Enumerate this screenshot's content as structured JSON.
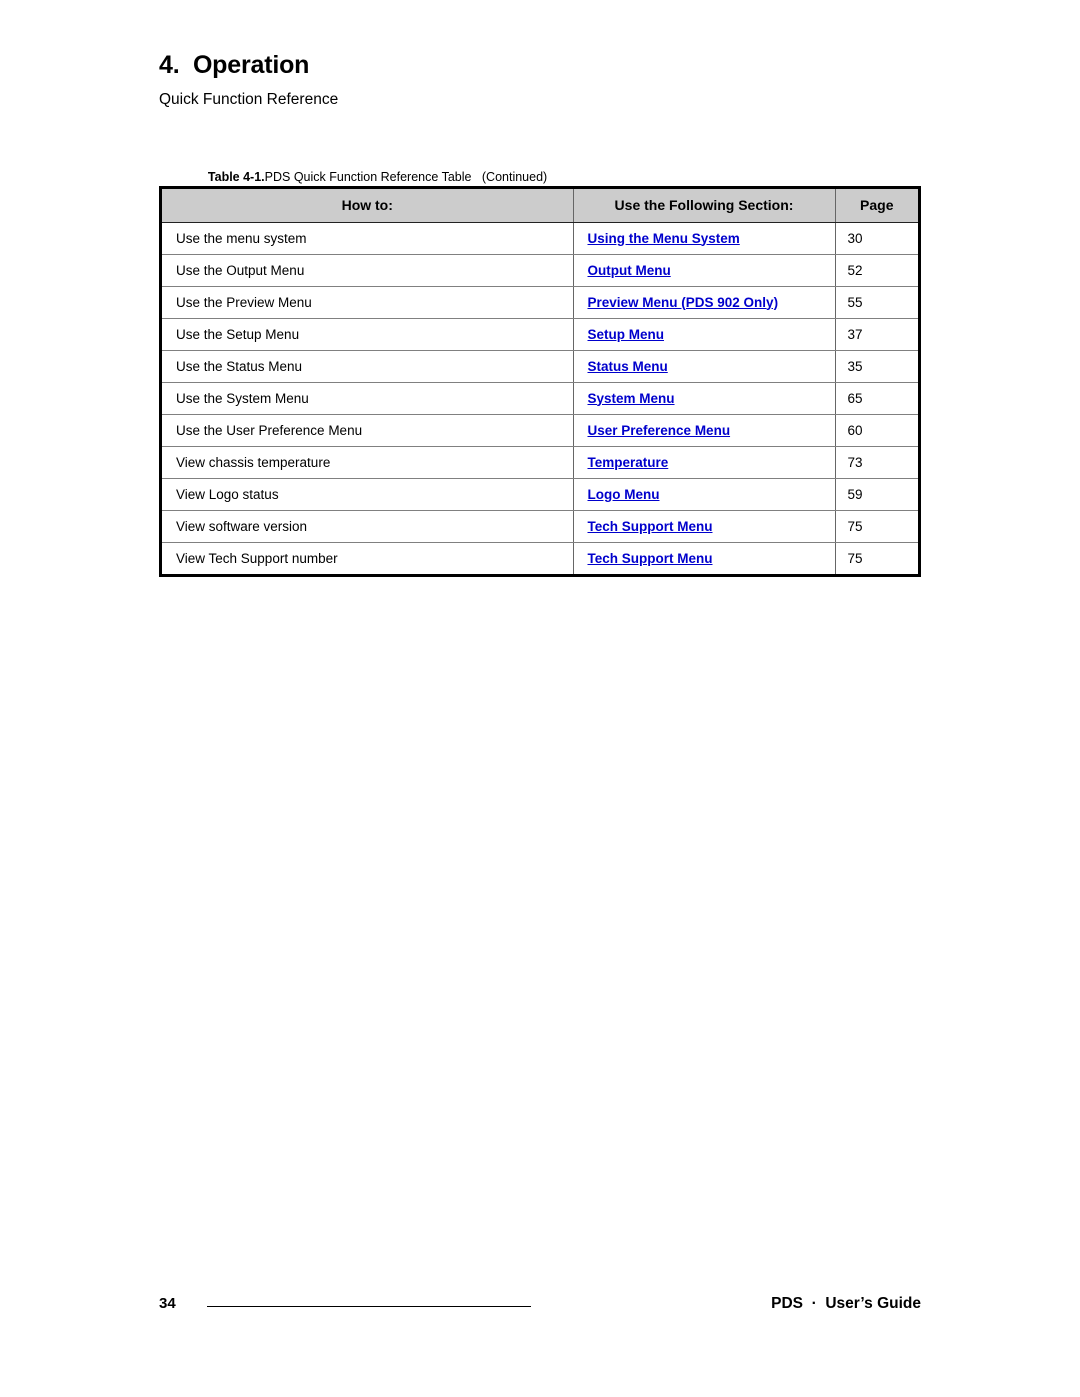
{
  "chapter": {
    "title": "4.  Operation",
    "subtitle": "Quick Function Reference"
  },
  "table_caption": {
    "label": "Table 4-1.",
    "text": "PDS Quick Function Reference Table   (Continued)"
  },
  "table": {
    "headers": {
      "how_to": "How to:",
      "section": "Use the Following Section:",
      "page": "Page"
    },
    "header_background": "#CCCCCC",
    "link_color": "#0000CC",
    "rows": [
      {
        "how_to": "Use the menu system",
        "section": "Using the Menu System",
        "page": "30"
      },
      {
        "how_to": "Use the Output Menu",
        "section": "Output Menu",
        "page": "52"
      },
      {
        "how_to": "Use the Preview Menu",
        "section": "Preview Menu (PDS 902 Only)",
        "page": "55"
      },
      {
        "how_to": "Use the Setup Menu",
        "section": "Setup Menu",
        "page": "37"
      },
      {
        "how_to": "Use the Status Menu",
        "section": "Status Menu",
        "page": "35"
      },
      {
        "how_to": "Use the System Menu",
        "section": "System Menu",
        "page": "65"
      },
      {
        "how_to": "Use the User Preference Menu",
        "section": "User Preference Menu",
        "page": "60"
      },
      {
        "how_to": "View chassis temperature",
        "section": "Temperature",
        "page": "73"
      },
      {
        "how_to": "View Logo status",
        "section": "Logo Menu",
        "page": "59"
      },
      {
        "how_to": "View software version",
        "section": "Tech Support Menu",
        "page": "75"
      },
      {
        "how_to": "View Tech Support number",
        "section": "Tech Support Menu",
        "page": "75"
      }
    ]
  },
  "footer": {
    "page_number": "34",
    "guide_text": "PDS  ·  User’s Guide"
  }
}
